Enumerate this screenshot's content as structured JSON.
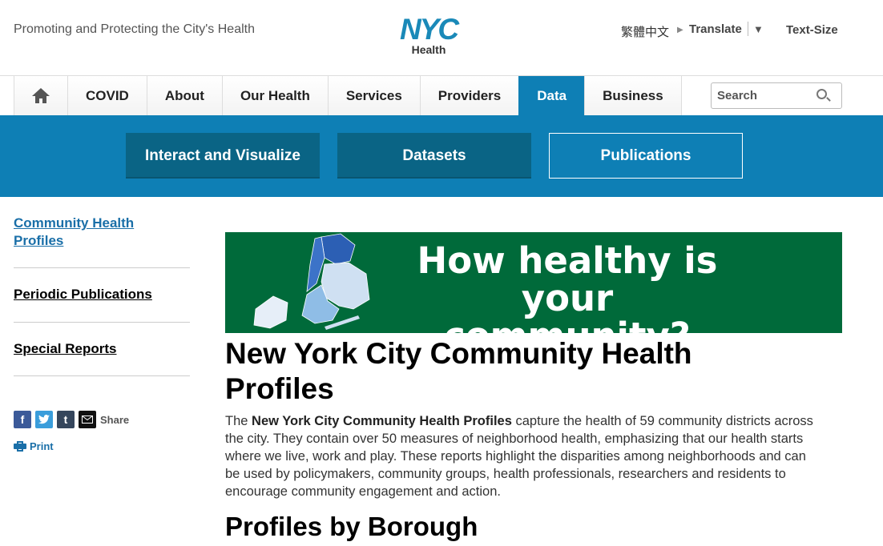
{
  "header": {
    "tagline": "Promoting and Protecting the City's Health",
    "logo_main": "NYC",
    "logo_sub": "Health",
    "language": "繁體中文",
    "translate": "Translate",
    "translate_caret": "▼",
    "text_size": "Text-Size"
  },
  "nav": {
    "items": [
      {
        "label": "COVID"
      },
      {
        "label": "About"
      },
      {
        "label": "Our Health"
      },
      {
        "label": "Services"
      },
      {
        "label": "Providers"
      },
      {
        "label": "Data"
      },
      {
        "label": "Business"
      }
    ],
    "active": "Data",
    "search_placeholder": "Search"
  },
  "subnav": {
    "items": [
      "Interact and Visualize",
      "Datasets",
      "Publications"
    ],
    "selected": "Publications"
  },
  "sidebar": {
    "links": [
      "Community Health Profiles",
      "Periodic Publications",
      "Special Reports"
    ],
    "share_label": "Share",
    "print_label": "Print"
  },
  "banner": {
    "line1": "How healthy is",
    "line2": "your community?"
  },
  "main": {
    "title": "New York City Community Health Profiles",
    "intro_lead": "The ",
    "intro_bold": "New York City Community Health Profiles",
    "intro_rest": " capture the health of 59 community districts across the city. They contain over 50 measures of neighborhood health, emphasizing that our health starts where we live, work and play. These reports highlight the disparities among neighborhoods and can be used by policymakers, community groups, health professionals, researchers and residents to encourage community engagement and action.",
    "section_heading": "Profiles by Borough"
  },
  "colors": {
    "brand_blue": "#0e7fb5",
    "subnav_dark": "#0a6485",
    "banner_green": "#006a3a",
    "link_blue": "#1a6fa8"
  }
}
